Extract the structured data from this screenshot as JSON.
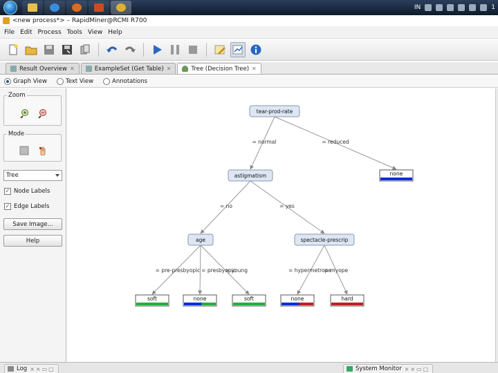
{
  "taskbar": {
    "buttons": [
      "explorer",
      "ie",
      "firefox",
      "powerpoint",
      "rapidminer"
    ],
    "tray_lang": "IN",
    "tray_clock": "1"
  },
  "window": {
    "title": "<new process*> – RapidMiner@RCMI R700"
  },
  "menu": [
    "File",
    "Edit",
    "Process",
    "Tools",
    "View",
    "Help"
  ],
  "toolbar": {
    "buttons": [
      "new-process",
      "open",
      "save",
      "save-as",
      "export",
      "undo",
      "redo",
      "run",
      "pause",
      "stop",
      "design-perspective",
      "result-perspective",
      "info"
    ]
  },
  "tabs": [
    {
      "label": "Result Overview",
      "active": false
    },
    {
      "label": "ExampleSet (Get Table)",
      "active": false
    },
    {
      "label": "Tree (Decision Tree)",
      "active": true
    }
  ],
  "view_options": [
    {
      "label": "Graph View",
      "selected": true
    },
    {
      "label": "Text View",
      "selected": false
    },
    {
      "label": "Annotations",
      "selected": false
    }
  ],
  "left_panel": {
    "zoom_label": "Zoom",
    "mode_label": "Mode",
    "layout_select": "Tree",
    "node_labels": "Node Labels",
    "edge_labels": "Edge Labels",
    "save_image": "Save Image...",
    "help": "Help"
  },
  "tree": {
    "nodes": [
      {
        "id": "n0",
        "label": "tear-prod-rate",
        "type": "inner"
      },
      {
        "id": "n1",
        "label": "astigmatism",
        "type": "inner"
      },
      {
        "id": "n2",
        "label": "none",
        "type": "leaf",
        "color": "#0a2fd8"
      },
      {
        "id": "n3",
        "label": "age",
        "type": "inner"
      },
      {
        "id": "n4",
        "label": "spectacle-prescrip",
        "type": "inner"
      },
      {
        "id": "n5",
        "label": "soft",
        "type": "leaf",
        "color": "#22b040"
      },
      {
        "id": "n6",
        "label": "none",
        "type": "leaf",
        "color": "#0a2fd8",
        "color2": "#22b040"
      },
      {
        "id": "n7",
        "label": "soft",
        "type": "leaf",
        "color": "#22b040"
      },
      {
        "id": "n8",
        "label": "none",
        "type": "leaf",
        "color": "#0a2fd8",
        "color2": "#c02020"
      },
      {
        "id": "n9",
        "label": "hard",
        "type": "leaf",
        "color": "#c02020"
      }
    ],
    "edges": [
      {
        "from": "n0",
        "to": "n1",
        "label": "= normal"
      },
      {
        "from": "n0",
        "to": "n2",
        "label": "= reduced"
      },
      {
        "from": "n1",
        "to": "n3",
        "label": "= no"
      },
      {
        "from": "n1",
        "to": "n4",
        "label": "= yes"
      },
      {
        "from": "n3",
        "to": "n5",
        "label": "= pre-presbyopic"
      },
      {
        "from": "n3",
        "to": "n6",
        "label": "= presbyopic"
      },
      {
        "from": "n3",
        "to": "n7",
        "label": "= young"
      },
      {
        "from": "n4",
        "to": "n8",
        "label": "= hypermetrope"
      },
      {
        "from": "n4",
        "to": "n9",
        "label": "= myope"
      }
    ]
  },
  "bottom": {
    "log_tab": "Log",
    "monitor_tab": "System Monitor"
  }
}
